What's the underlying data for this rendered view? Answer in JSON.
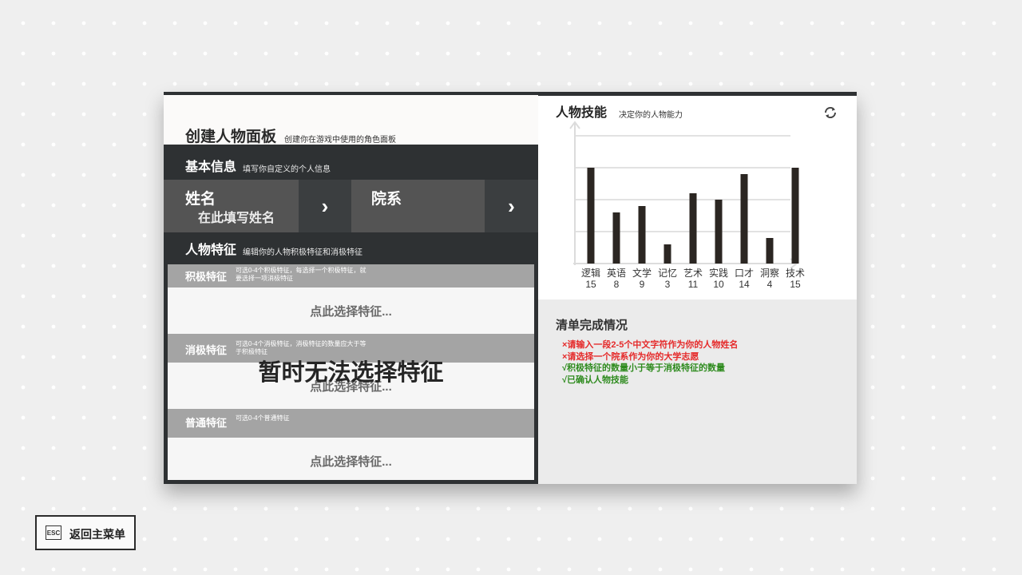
{
  "left": {
    "title": "创建人物面板",
    "subtitle": "创建你在游戏中使用的角色面板",
    "basic_info": {
      "title": "基本信息",
      "subtitle": "填写你自定义的个人信息"
    },
    "name_field": {
      "label": "姓名",
      "placeholder": "在此填写姓名",
      "arrow": "›"
    },
    "school_field": {
      "label": "院系",
      "arrow": "›"
    },
    "traits_section": {
      "title": "人物特征",
      "subtitle": "编辑你的人物积极特征和消极特征"
    },
    "traits": [
      {
        "name": "积极特征",
        "desc": "可选0-4个积极特征，每选择一个积极特征，就要选择一项消极特征",
        "select": "点此选择特征..."
      },
      {
        "name": "消极特征",
        "desc": "可选0-4个消极特征，消极特征的数量应大于等于积极特征",
        "select": "点此选择特征..."
      },
      {
        "name": "普通特征",
        "desc": "可选0-4个普通特征",
        "select": "点此选择特征..."
      }
    ],
    "overlay": "暂时无法选择特征"
  },
  "right": {
    "skills": {
      "title": "人物技能",
      "subtitle": "决定你的人物能力",
      "refresh_icon": "refresh-icon"
    },
    "checklist": {
      "title": "清单完成情况",
      "items": [
        {
          "text": "×请输入一段2-5个中文字符作为你的人物姓名",
          "status": "error",
          "color": "#e52a2a"
        },
        {
          "text": "×请选择一个院系作为你的大学志愿",
          "status": "error",
          "color": "#e52a2a"
        },
        {
          "text": "√积极特征的数量小于等于消极特征的数量",
          "status": "ok",
          "color": "#2e8b1e"
        },
        {
          "text": "√已确认人物技能",
          "status": "ok",
          "color": "#2e8b1e"
        }
      ]
    }
  },
  "chart_data": {
    "type": "bar",
    "categories": [
      "逻辑",
      "英语",
      "文学",
      "记忆",
      "艺术",
      "实践",
      "口才",
      "洞察",
      "技术"
    ],
    "values": [
      15,
      8,
      9,
      3,
      11,
      10,
      14,
      4,
      15
    ],
    "ylim": [
      0,
      20
    ],
    "grid": true,
    "bar_color": "#2b2622"
  },
  "esc": {
    "key": "ESC",
    "label": "返回主菜单"
  }
}
